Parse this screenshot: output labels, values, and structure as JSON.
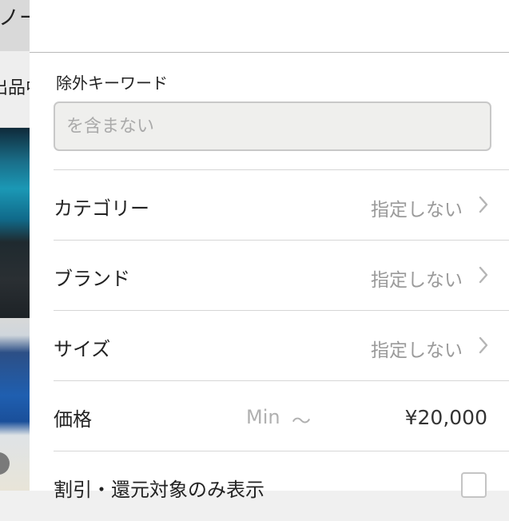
{
  "background_page": {
    "text_top": "ノー",
    "text_second": "出品中の"
  },
  "filter": {
    "keyword_exclude": {
      "label": "除外キーワード",
      "placeholder": "を含まない",
      "value": ""
    },
    "rows": [
      {
        "label": "カテゴリー",
        "value": "指定しない",
        "icon": "chevron-right-icon"
      },
      {
        "label": "ブランド",
        "value": "指定しない",
        "icon": "chevron-right-icon"
      },
      {
        "label": "サイズ",
        "value": "指定しない",
        "icon": "chevron-right-icon"
      }
    ],
    "price": {
      "label": "価格",
      "min_placeholder": "Min",
      "separator": "〜",
      "max_value": "¥20,000"
    },
    "discount": {
      "label": "割引・還元対象のみ表示",
      "checked": false
    }
  }
}
